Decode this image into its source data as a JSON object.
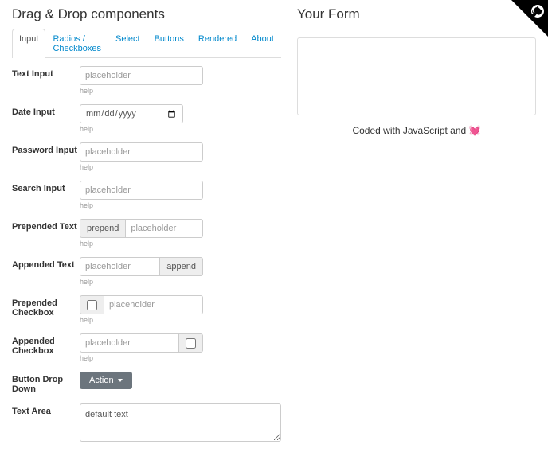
{
  "left_title": "Drag & Drop components",
  "right_title": "Your Form",
  "tabs": [
    "Input",
    "Radios / Checkboxes",
    "Select",
    "Buttons",
    "Rendered",
    "About"
  ],
  "active_tab": 0,
  "fields": {
    "text_input": {
      "label": "Text Input",
      "placeholder": "placeholder",
      "help": "help"
    },
    "date_input": {
      "label": "Date Input",
      "placeholder": "dd/mm/yyyy",
      "help": "help"
    },
    "password_input": {
      "label": "Password Input",
      "placeholder": "placeholder",
      "help": "help"
    },
    "search_input": {
      "label": "Search Input",
      "placeholder": "placeholder",
      "help": "help"
    },
    "prepended_text": {
      "label": "Prepended Text",
      "addon": "prepend",
      "placeholder": "placeholder",
      "help": "help"
    },
    "appended_text": {
      "label": "Appended Text",
      "addon": "append",
      "placeholder": "placeholder",
      "help": "help"
    },
    "prepended_checkbox": {
      "label": "Prepended Checkbox",
      "placeholder": "placeholder",
      "help": "help"
    },
    "appended_checkbox": {
      "label": "Appended Checkbox",
      "placeholder": "placeholder",
      "help": "help"
    },
    "button_dropdown": {
      "label": "Button Drop Down",
      "button": "Action"
    },
    "text_area": {
      "label": "Text Area",
      "value": "default text"
    }
  },
  "footer": {
    "text": "Coded with JavaScript and ",
    "heart": "💓"
  }
}
